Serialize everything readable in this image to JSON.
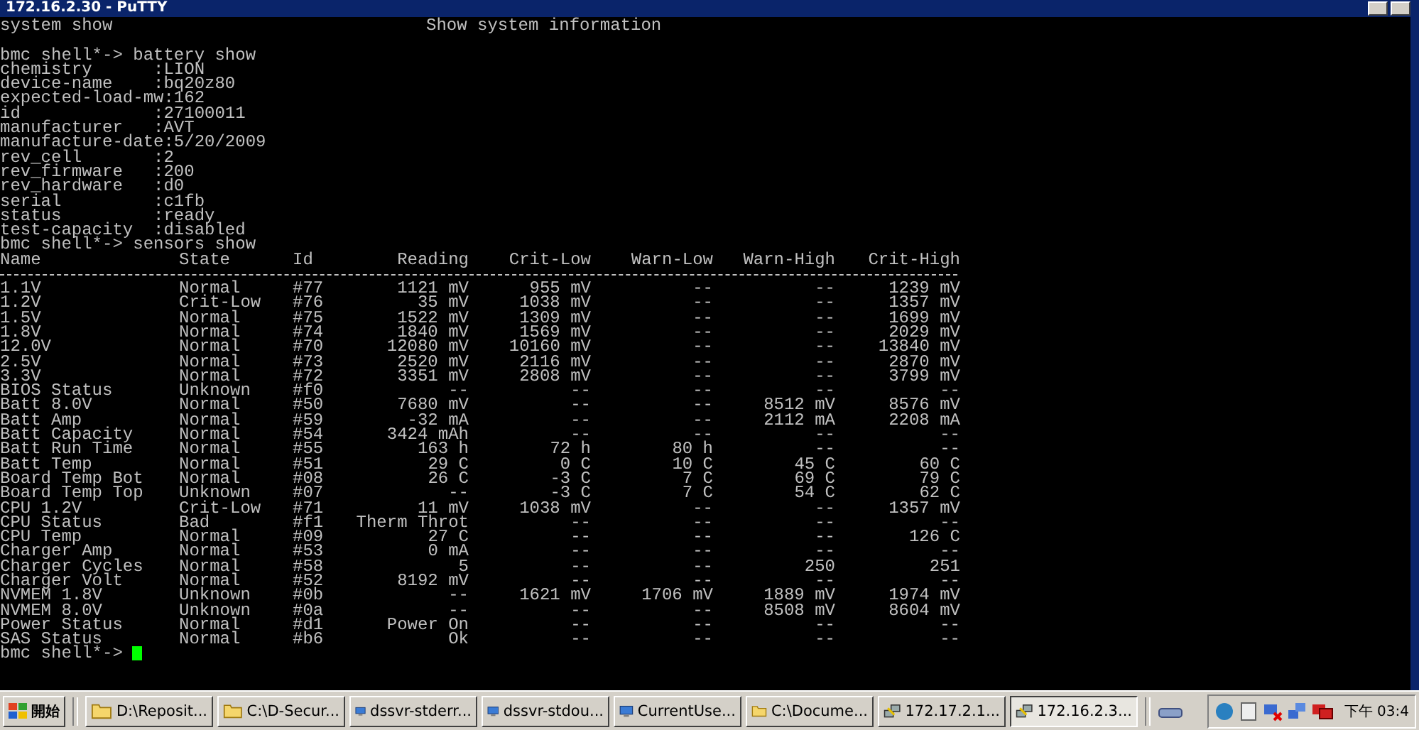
{
  "window": {
    "title": "172.16.2.30 - PuTTY"
  },
  "terminal": {
    "first_line": {
      "command": "system show",
      "description": "Show system information"
    },
    "battery_command": "bmc shell*-> battery show",
    "battery_attributes": [
      {
        "key": "chemistry",
        "value": ":LION"
      },
      {
        "key": "device-name",
        "value": ":bq20z80"
      },
      {
        "key": "expected-load-mw",
        "value": ":162"
      },
      {
        "key": "id",
        "value": ":27100011"
      },
      {
        "key": "manufacturer",
        "value": ":AVT"
      },
      {
        "key": "manufacture-date",
        "value": ":5/20/2009"
      },
      {
        "key": "rev_cell",
        "value": ":2"
      },
      {
        "key": "rev_firmware",
        "value": ":200"
      },
      {
        "key": "rev_hardware",
        "value": ":d0"
      },
      {
        "key": "serial",
        "value": ":c1fb"
      },
      {
        "key": "status",
        "value": ":ready"
      },
      {
        "key": "test-capacity",
        "value": ":disabled"
      }
    ],
    "sensors_command": "bmc shell*-> sensors show",
    "sensor_columns": [
      "Name",
      "State",
      "Id",
      "Reading",
      "Crit-Low",
      "Warn-Low",
      "Warn-High",
      "Crit-High"
    ],
    "sensor_rows": [
      [
        "1.1V",
        "Normal",
        "#77",
        "1121 mV",
        "955 mV",
        "--",
        "--",
        "1239 mV"
      ],
      [
        "1.2V",
        "Crit-Low",
        "#76",
        "35 mV",
        "1038 mV",
        "--",
        "--",
        "1357 mV"
      ],
      [
        "1.5V",
        "Normal",
        "#75",
        "1522 mV",
        "1309 mV",
        "--",
        "--",
        "1699 mV"
      ],
      [
        "1.8V",
        "Normal",
        "#74",
        "1840 mV",
        "1569 mV",
        "--",
        "--",
        "2029 mV"
      ],
      [
        "12.0V",
        "Normal",
        "#70",
        "12080 mV",
        "10160 mV",
        "--",
        "--",
        "13840 mV"
      ],
      [
        "2.5V",
        "Normal",
        "#73",
        "2520 mV",
        "2116 mV",
        "--",
        "--",
        "2870 mV"
      ],
      [
        "3.3V",
        "Normal",
        "#72",
        "3351 mV",
        "2808 mV",
        "--",
        "--",
        "3799 mV"
      ],
      [
        "BIOS Status",
        "Unknown",
        "#f0",
        "--",
        "--",
        "--",
        "--",
        "--"
      ],
      [
        "Batt 8.0V",
        "Normal",
        "#50",
        "7680 mV",
        "--",
        "--",
        "8512 mV",
        "8576 mV"
      ],
      [
        "Batt Amp",
        "Normal",
        "#59",
        "-32 mA",
        "--",
        "--",
        "2112 mA",
        "2208 mA"
      ],
      [
        "Batt Capacity",
        "Normal",
        "#54",
        "3424 mAh",
        "--",
        "--",
        "--",
        "--"
      ],
      [
        "Batt Run Time",
        "Normal",
        "#55",
        "163 h",
        "72 h",
        "80 h",
        "--",
        "--"
      ],
      [
        "Batt Temp",
        "Normal",
        "#51",
        "29 C",
        "0 C",
        "10 C",
        "45 C",
        "60 C"
      ],
      [
        "Board Temp Bot",
        "Normal",
        "#08",
        "26 C",
        "-3 C",
        "7 C",
        "69 C",
        "79 C"
      ],
      [
        "Board Temp Top",
        "Unknown",
        "#07",
        "--",
        "-3 C",
        "7 C",
        "54 C",
        "62 C"
      ],
      [
        "CPU 1.2V",
        "Crit-Low",
        "#71",
        "11 mV",
        "1038 mV",
        "--",
        "--",
        "1357 mV"
      ],
      [
        "CPU Status",
        "Bad",
        "#f1",
        "Therm Throt",
        "--",
        "--",
        "--",
        "--"
      ],
      [
        "CPU Temp",
        "Normal",
        "#09",
        "27 C",
        "--",
        "--",
        "--",
        "126 C"
      ],
      [
        "Charger Amp",
        "Normal",
        "#53",
        "0 mA",
        "--",
        "--",
        "--",
        "--"
      ],
      [
        "Charger Cycles",
        "Normal",
        "#58",
        "5",
        "--",
        "--",
        "250",
        "251"
      ],
      [
        "Charger Volt",
        "Normal",
        "#52",
        "8192 mV",
        "--",
        "--",
        "--",
        "--"
      ],
      [
        "NVMEM 1.8V",
        "Unknown",
        "#0b",
        "--",
        "1621 mV",
        "1706 mV",
        "1889 mV",
        "1974 mV"
      ],
      [
        "NVMEM 8.0V",
        "Unknown",
        "#0a",
        "--",
        "--",
        "--",
        "8508 mV",
        "8604 mV"
      ],
      [
        "Power Status",
        "Normal",
        "#d1",
        "Power On",
        "--",
        "--",
        "--",
        "--"
      ],
      [
        "SAS Status",
        "Normal",
        "#b6",
        "Ok",
        "--",
        "--",
        "--",
        "--"
      ]
    ],
    "final_prompt": "bmc shell*->"
  },
  "taskbar": {
    "start_label": "開始",
    "tasks": [
      {
        "label": "D:\\Reposit...",
        "kind": "folder",
        "selected": false
      },
      {
        "label": "C:\\D-Secur...",
        "kind": "folder",
        "selected": false
      },
      {
        "label": "dssvr-stderr...",
        "kind": "window",
        "selected": false
      },
      {
        "label": "dssvr-stdou...",
        "kind": "window",
        "selected": false
      },
      {
        "label": "CurrentUse...",
        "kind": "window",
        "selected": false
      },
      {
        "label": "C:\\Docume...",
        "kind": "folder",
        "selected": false
      },
      {
        "label": "172.17.2.1...",
        "kind": "terminal",
        "selected": false
      },
      {
        "label": "172.16.2.3...",
        "kind": "terminal",
        "selected": true
      }
    ],
    "clock": "下午 03:4"
  }
}
